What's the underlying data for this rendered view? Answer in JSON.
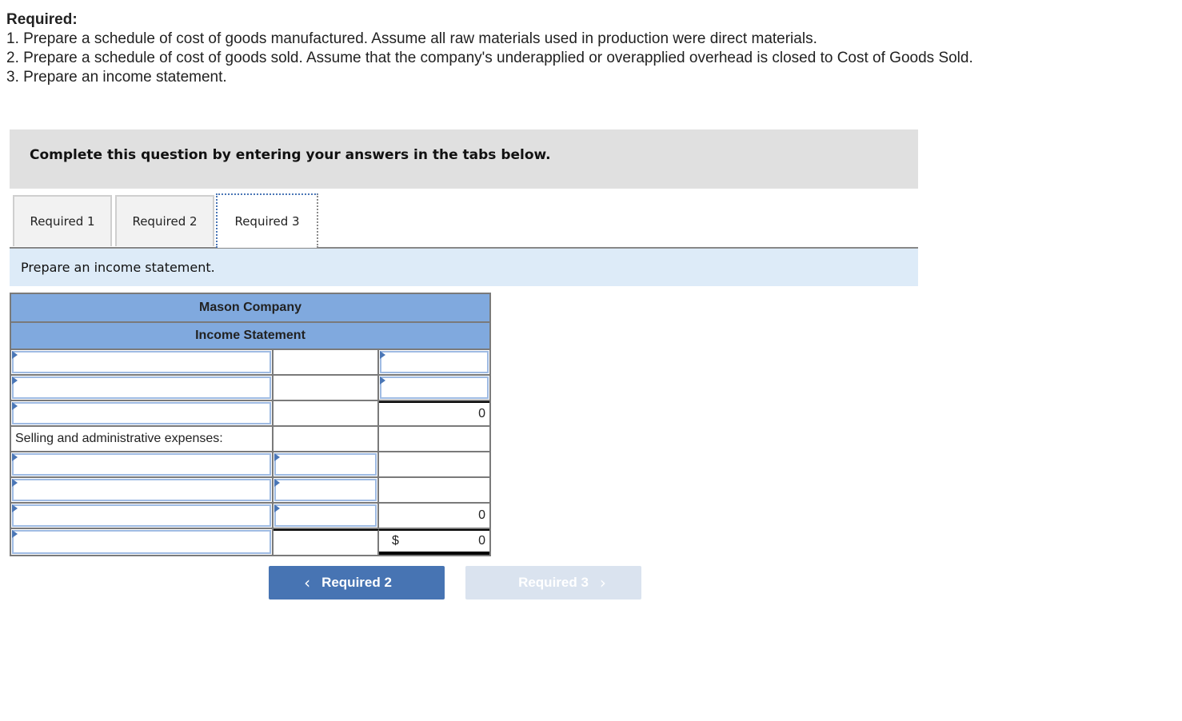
{
  "required": {
    "heading": "Required:",
    "lines": [
      "1. Prepare a schedule of cost of goods manufactured. Assume all raw materials used in production were direct materials.",
      "2. Prepare a schedule of cost of goods sold. Assume that the company's underapplied or overapplied overhead is closed to Cost of Goods Sold.",
      "3. Prepare an income statement."
    ]
  },
  "instruction": "Complete this question by entering your answers in the tabs below.",
  "tabs": [
    {
      "label": "Required 1",
      "active": false
    },
    {
      "label": "Required 2",
      "active": false
    },
    {
      "label": "Required 3",
      "active": true
    }
  ],
  "prompt": "Prepare an income statement.",
  "statement": {
    "company": "Mason Company",
    "title": "Income Statement",
    "selling_admin_label": "Selling and administrative expenses:",
    "gross_margin_value": "0",
    "total_sa_value": "0",
    "net_income_currency": "$",
    "net_income_value": "0"
  },
  "nav": {
    "prev_label": "Required 2",
    "next_label": "Required 3",
    "prev_icon": "chevron-left-icon",
    "next_icon": "chevron-right-icon"
  }
}
